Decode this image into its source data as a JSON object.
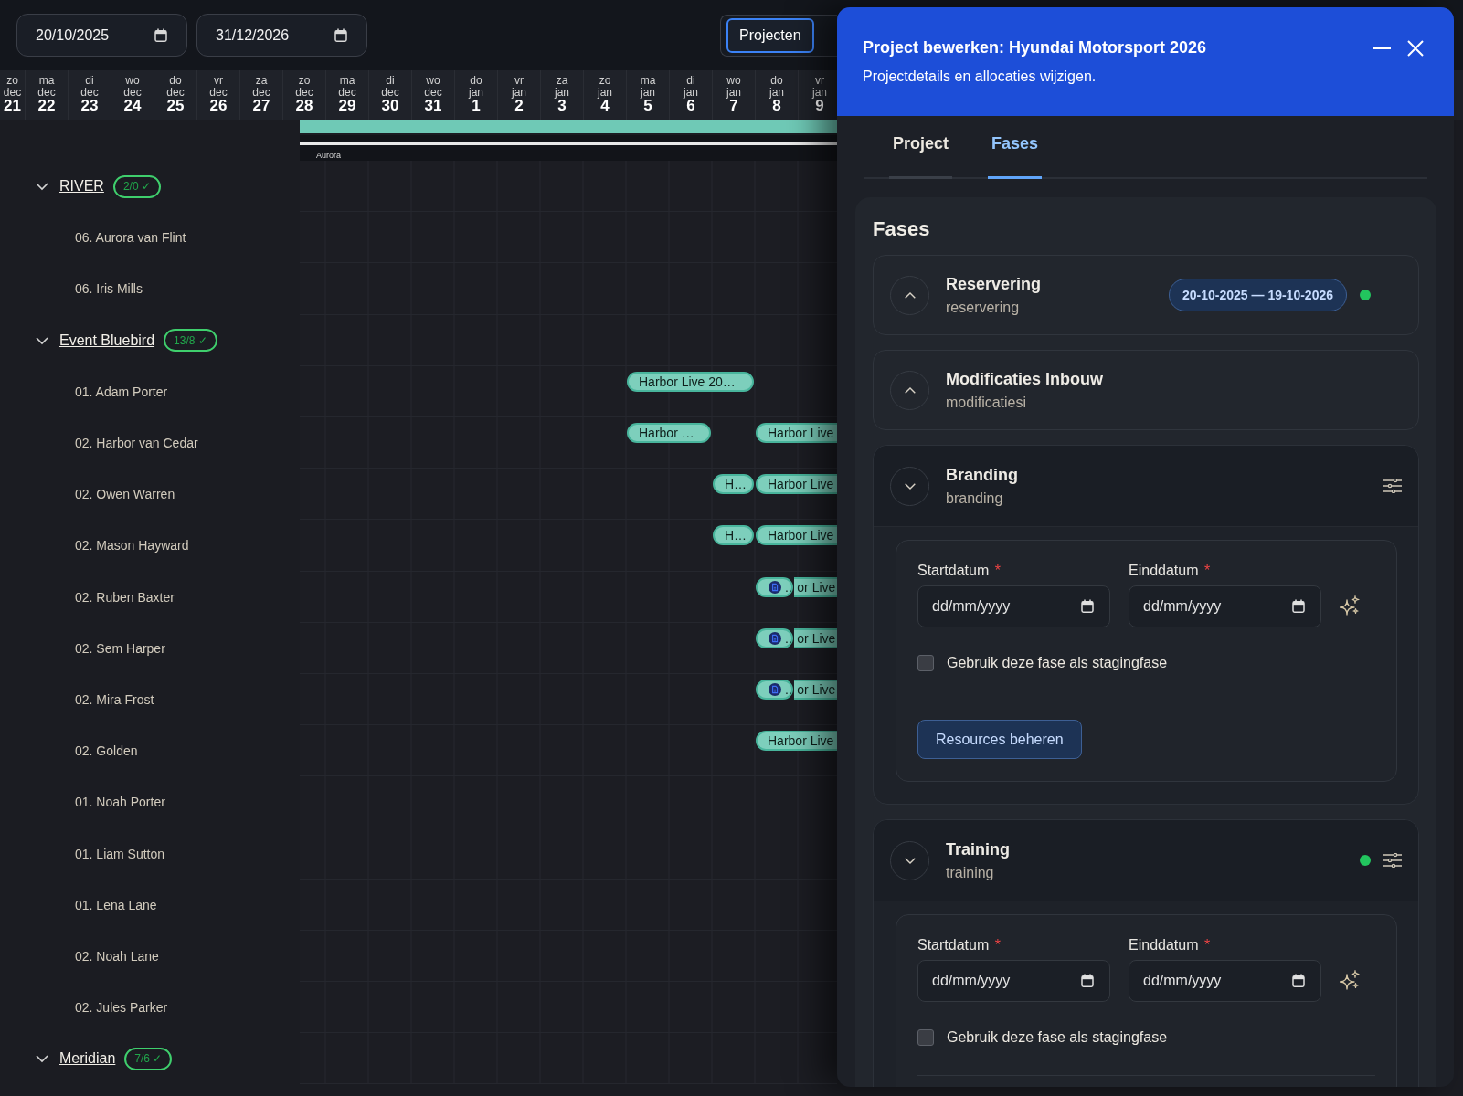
{
  "date_range": {
    "start": "20/10/2025",
    "end": "31/12/2026"
  },
  "view_toggle": [
    {
      "label": "Projecten",
      "selected": true
    }
  ],
  "timeline": {
    "days": [
      {
        "weekday": "zo",
        "month": "dec",
        "day": "21"
      },
      {
        "weekday": "ma",
        "month": "dec",
        "day": "22"
      },
      {
        "weekday": "di",
        "month": "dec",
        "day": "23"
      },
      {
        "weekday": "wo",
        "month": "dec",
        "day": "24"
      },
      {
        "weekday": "do",
        "month": "dec",
        "day": "25"
      },
      {
        "weekday": "vr",
        "month": "dec",
        "day": "26"
      },
      {
        "weekday": "za",
        "month": "dec",
        "day": "27"
      },
      {
        "weekday": "zo",
        "month": "dec",
        "day": "28"
      },
      {
        "weekday": "ma",
        "month": "dec",
        "day": "29"
      },
      {
        "weekday": "di",
        "month": "dec",
        "day": "30"
      },
      {
        "weekday": "wo",
        "month": "dec",
        "day": "31"
      },
      {
        "weekday": "do",
        "month": "jan",
        "day": "1"
      },
      {
        "weekday": "vr",
        "month": "jan",
        "day": "2"
      },
      {
        "weekday": "za",
        "month": "jan",
        "day": "3"
      },
      {
        "weekday": "zo",
        "month": "jan",
        "day": "4"
      },
      {
        "weekday": "ma",
        "month": "jan",
        "day": "5"
      },
      {
        "weekday": "di",
        "month": "jan",
        "day": "6"
      },
      {
        "weekday": "wo",
        "month": "jan",
        "day": "7"
      },
      {
        "weekday": "do",
        "month": "jan",
        "day": "8"
      },
      {
        "weekday": "vr",
        "month": "jan",
        "day": "9"
      }
    ],
    "summary_label": "Aurora"
  },
  "resources": [
    {
      "name": "RIVER",
      "badge": "2/0 ✓",
      "expanded": true,
      "children": [
        {
          "name": "06. Aurora van Flint"
        },
        {
          "name": "06. Iris Mills"
        }
      ]
    },
    {
      "name": "Event Bluebird",
      "badge": "13/8 ✓",
      "expanded": true,
      "children": [
        {
          "name": "01. Adam Porter",
          "bars": [
            {
              "label": "Harbor Live 20…",
              "kind": "text"
            }
          ]
        },
        {
          "name": "02. Harbor van Cedar",
          "bars": [
            {
              "label": "Harbor …",
              "kind": "text"
            },
            {
              "label": "Harbor Live",
              "kind": "text"
            }
          ]
        },
        {
          "name": "02. Owen Warren",
          "bars": [
            {
              "label": "H…",
              "kind": "text"
            },
            {
              "label": "Harbor Live",
              "kind": "text"
            }
          ]
        },
        {
          "name": "02. Mason Hayward",
          "bars": [
            {
              "label": "H…",
              "kind": "text"
            },
            {
              "label": "Harbor Live",
              "kind": "text"
            }
          ]
        },
        {
          "name": "02. Ruben Baxter",
          "bars": [
            {
              "label": "..",
              "kind": "icon"
            },
            {
              "label": "or Live",
              "kind": "text"
            }
          ]
        },
        {
          "name": "02. Sem Harper",
          "bars": [
            {
              "label": "..",
              "kind": "icon"
            },
            {
              "label": "or Live",
              "kind": "text"
            }
          ]
        },
        {
          "name": "02. Mira Frost",
          "bars": [
            {
              "label": "..",
              "kind": "icon"
            },
            {
              "label": "or Live",
              "kind": "text"
            }
          ]
        },
        {
          "name": "02. Golden",
          "bars": [
            {
              "label": "Harbor Live",
              "kind": "text"
            }
          ]
        },
        {
          "name": "01. Noah Porter"
        },
        {
          "name": "01. Liam Sutton"
        },
        {
          "name": "01. Lena Lane"
        },
        {
          "name": "02. Noah Lane"
        },
        {
          "name": "02. Jules Parker"
        }
      ]
    },
    {
      "name": "Meridian",
      "badge": "7/6 ✓",
      "expanded": true
    }
  ],
  "panel": {
    "title": "Project bewerken: Hyundai Motorsport 2026",
    "subtitle": "Projectdetails en allocaties wijzigen.",
    "tabs": [
      {
        "label": "Project",
        "selected": false
      },
      {
        "label": "Fases",
        "selected": true
      }
    ],
    "section_title": "Fases",
    "phases": [
      {
        "title": "Reservering",
        "subtitle": "reservering",
        "expanded": false,
        "indicator": true,
        "date_range": "20-10-2025 — 19-10-2026"
      },
      {
        "title": "Modificaties Inbouw",
        "subtitle": "modificatiesi",
        "expanded": false,
        "indicator": false
      },
      {
        "title": "Branding",
        "subtitle": "branding",
        "expanded": true,
        "indicator": false,
        "fields": [
          {
            "label": "Startdatum",
            "mark": "*",
            "placeholder": "dd/mm/yyyy"
          },
          {
            "label": "Einddatum",
            "mark": "*",
            "placeholder": "dd/mm/yyyy"
          }
        ],
        "staging": {
          "label": "Gebruik deze fase als stagingfase",
          "checked": false
        },
        "button": "Resources beheren"
      },
      {
        "title": "Training",
        "subtitle": "training",
        "expanded": true,
        "indicator": true,
        "fields": [
          {
            "label": "Startdatum",
            "mark": "*",
            "placeholder": "dd/mm/yyyy"
          },
          {
            "label": "Einddatum",
            "mark": "*",
            "placeholder": "dd/mm/yyyy"
          }
        ],
        "staging": {
          "label": "Gebruik deze fase als stagingfase",
          "checked": false
        }
      }
    ]
  }
}
